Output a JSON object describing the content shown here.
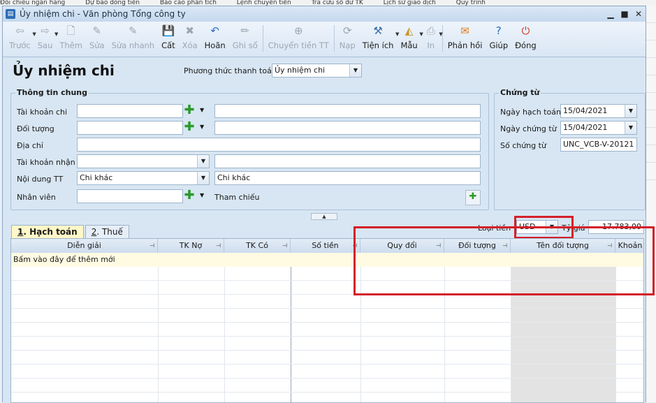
{
  "background_app": {
    "top_menu": [
      "Đối chiếu ngân hàng",
      "Dự báo dòng tiền",
      "Báo cáo phân tích",
      "Lệnh chuyển tiền",
      "Tra cứu số dư TK",
      "Lịch sử giao dịch",
      "Quy trình"
    ]
  },
  "window": {
    "title": "Ủy nhiệm chi - Văn phòng Tổng công ty",
    "minimize": "▁",
    "maximize": "■",
    "close": "✕"
  },
  "toolbar": {
    "back": "Trước",
    "next": "Sau",
    "add": "Thêm",
    "edit": "Sửa",
    "quick_edit": "Sửa nhanh",
    "save": "Cất",
    "delete": "Xóa",
    "undo": "Hoãn",
    "post": "Ghi sổ",
    "transfer": "Chuyển tiền TT",
    "load": "Nạp",
    "utilities": "Tiện ích",
    "template": "Mẫu",
    "print": "In",
    "feedback": "Phản hồi",
    "help": "Giúp",
    "close": "Đóng"
  },
  "form": {
    "title": "Ủy nhiệm chi",
    "payment_method_label": "Phương thức thanh toán",
    "payment_method_value": "Ủy nhiệm chi",
    "general_info": {
      "title": "Thông tin chung",
      "account_pay_label": "Tài khoản chi",
      "account_pay_value": "",
      "account_pay_name": "",
      "object_label": "Đối tượng",
      "object_value": "",
      "object_name": "",
      "address_label": "Địa chỉ",
      "address_value": "",
      "account_receive_label": "Tài khoản nhận",
      "account_receive_value": "",
      "account_receive_name": "",
      "content_label": "Nội dung TT",
      "content_value": "Chi khác",
      "content_text": "Chi khác",
      "employee_label": "Nhân viên",
      "employee_value": "",
      "reference_label": "Tham chiếu"
    },
    "voucher": {
      "title": "Chứng từ",
      "posting_date_label": "Ngày hạch toán",
      "posting_date_value": "15/04/2021",
      "voucher_date_label": "Ngày chứng từ",
      "voucher_date_value": "15/04/2021",
      "voucher_no_label": "Số chứng từ",
      "voucher_no_value": "UNC_VCB-V-20121"
    },
    "currency_label": "Loại tiền",
    "currency_value": "USD",
    "rate_label": "Tỷ giá",
    "rate_value": "17.783,00"
  },
  "tabs": [
    {
      "num": "1",
      "label": ". Hạch toán"
    },
    {
      "num": "2",
      "label": ". Thuế"
    }
  ],
  "grid": {
    "columns": [
      "Diễn giải",
      "TK Nợ",
      "TK Có",
      "Số tiền",
      "Quy đổi",
      "Đối tượng",
      "Tên đối tượng",
      "Khoản"
    ],
    "add_row_text": "Bấm vào đây để thêm mới"
  },
  "colors": {
    "highlight_red": "#d4202a",
    "window_bg": "#d8e6f3",
    "add_row_bg": "#fffbe3"
  }
}
